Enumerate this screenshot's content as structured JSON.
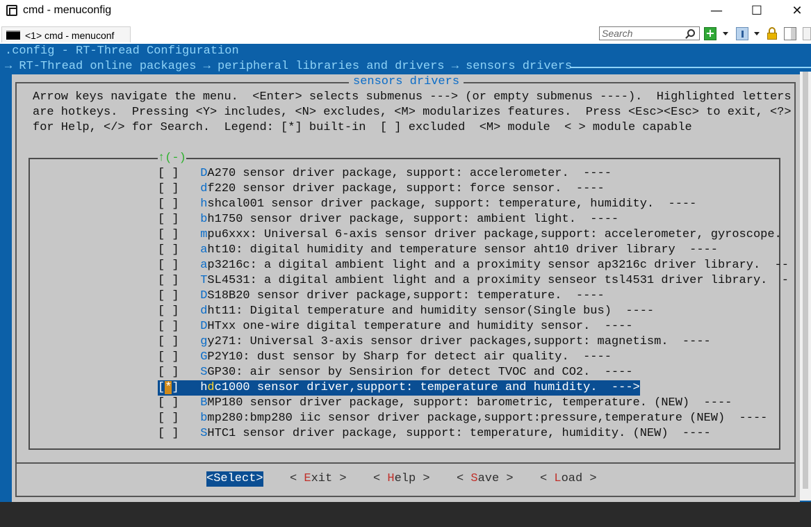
{
  "window": {
    "title": "cmd - menuconfig",
    "minimize_glyph": "—",
    "maximize_glyph": "☐",
    "close_glyph": "✕"
  },
  "tabbar": {
    "tab_label": "<1> cmd - menuconf",
    "search_placeholder": "Search"
  },
  "terminal": {
    "config_line": ".config - RT-Thread Configuration",
    "breadcrumb": "→ RT-Thread online packages → peripheral libraries and drivers → sensors drivers"
  },
  "dialog": {
    "title": "sensors drivers",
    "help_lines": [
      "Arrow keys navigate the menu.  <Enter> selects submenus ---> (or empty submenus ----).  Highlighted letters",
      "are hotkeys.  Pressing <Y> includes, <N> excludes, <M> modularizes features.  Press <Esc><Esc> to exit, <?>",
      "for Help, </> for Search.  Legend: [*] built-in  [ ] excluded  <M> module  < > module capable"
    ],
    "scroll_marker": "↑(-)",
    "items": [
      {
        "check": "[ ]",
        "hotkey": "D",
        "rest": "A270 sensor driver package, support: accelerometer.  ----"
      },
      {
        "check": "[ ]",
        "hotkey": "d",
        "rest": "f220 sensor driver package, support: force sensor.  ----"
      },
      {
        "check": "[ ]",
        "hotkey": "h",
        "rest": "shcal001 sensor driver package, support: temperature, humidity.  ----"
      },
      {
        "check": "[ ]",
        "hotkey": "b",
        "rest": "h1750 sensor driver package, support: ambient light.  ----"
      },
      {
        "check": "[ ]",
        "hotkey": "m",
        "rest": "pu6xxx: Universal 6-axis sensor driver package,support: accelerometer, gyroscope."
      },
      {
        "check": "[ ]",
        "hotkey": "a",
        "rest": "ht10: digital humidity and temperature sensor aht10 driver library  ----"
      },
      {
        "check": "[ ]",
        "hotkey": "a",
        "rest": "p3216c: a digital ambient light and a proximity sensor ap3216c driver library.  --"
      },
      {
        "check": "[ ]",
        "hotkey": "T",
        "rest": "SL4531: a digital ambient light and a proximity senseor tsl4531 driver library.  -"
      },
      {
        "check": "[ ]",
        "hotkey": "D",
        "rest": "S18B20 sensor driver package,support: temperature.  ----"
      },
      {
        "check": "[ ]",
        "hotkey": "d",
        "rest": "ht11: Digital temperature and humidity sensor(Single bus)  ----"
      },
      {
        "check": "[ ]",
        "hotkey": "D",
        "rest": "HTxx one-wire digital temperature and humidity sensor.  ----"
      },
      {
        "check": "[ ]",
        "hotkey": "g",
        "rest": "y271: Universal 3-axis sensor driver packages,support: magnetism.  ----"
      },
      {
        "check": "[ ]",
        "hotkey": "G",
        "rest": "P2Y10: dust sensor by Sharp for detect air quality.  ----"
      },
      {
        "check": "[ ]",
        "hotkey": "S",
        "rest": "GP30: air sensor by Sensirion for detect TVOC and CO2.  ----"
      },
      {
        "check": "[*]",
        "hotkey": "d",
        "prefix": "h",
        "rest": "c1000 sensor driver,support: temperature and humidity.  --->",
        "selected": true
      },
      {
        "check": "[ ]",
        "hotkey": "B",
        "rest": "MP180 sensor driver package, support: barometric, temperature. (NEW)  ----"
      },
      {
        "check": "[ ]",
        "hotkey": "b",
        "rest": "mp280:bmp280 iic sensor driver package,support:pressure,temperature (NEW)  ----"
      },
      {
        "check": "[ ]",
        "hotkey": "S",
        "rest": "HTC1 sensor driver package, support: temperature, humidity. (NEW)  ----"
      }
    ],
    "buttons": {
      "select": {
        "pre": "<",
        "hotkey": "S",
        "post": "elect>"
      },
      "exit": {
        "pre": "< ",
        "hotkey": "E",
        "post": "xit >"
      },
      "help": {
        "pre": "< ",
        "hotkey": "H",
        "post": "elp >"
      },
      "save": {
        "pre": "< ",
        "hotkey": "S",
        "post": "ave >"
      },
      "load": {
        "pre": "< ",
        "hotkey": "L",
        "post": "oad >"
      }
    }
  },
  "colors": {
    "terminal_bg": "#0c60a8",
    "terminal_fg": "#8fd3f7",
    "dialog_bg": "#c7c7c7",
    "hotkey": "#0a6cc8",
    "selection_bg": "#0a4e93",
    "button_hotkey": "#c0302a"
  }
}
